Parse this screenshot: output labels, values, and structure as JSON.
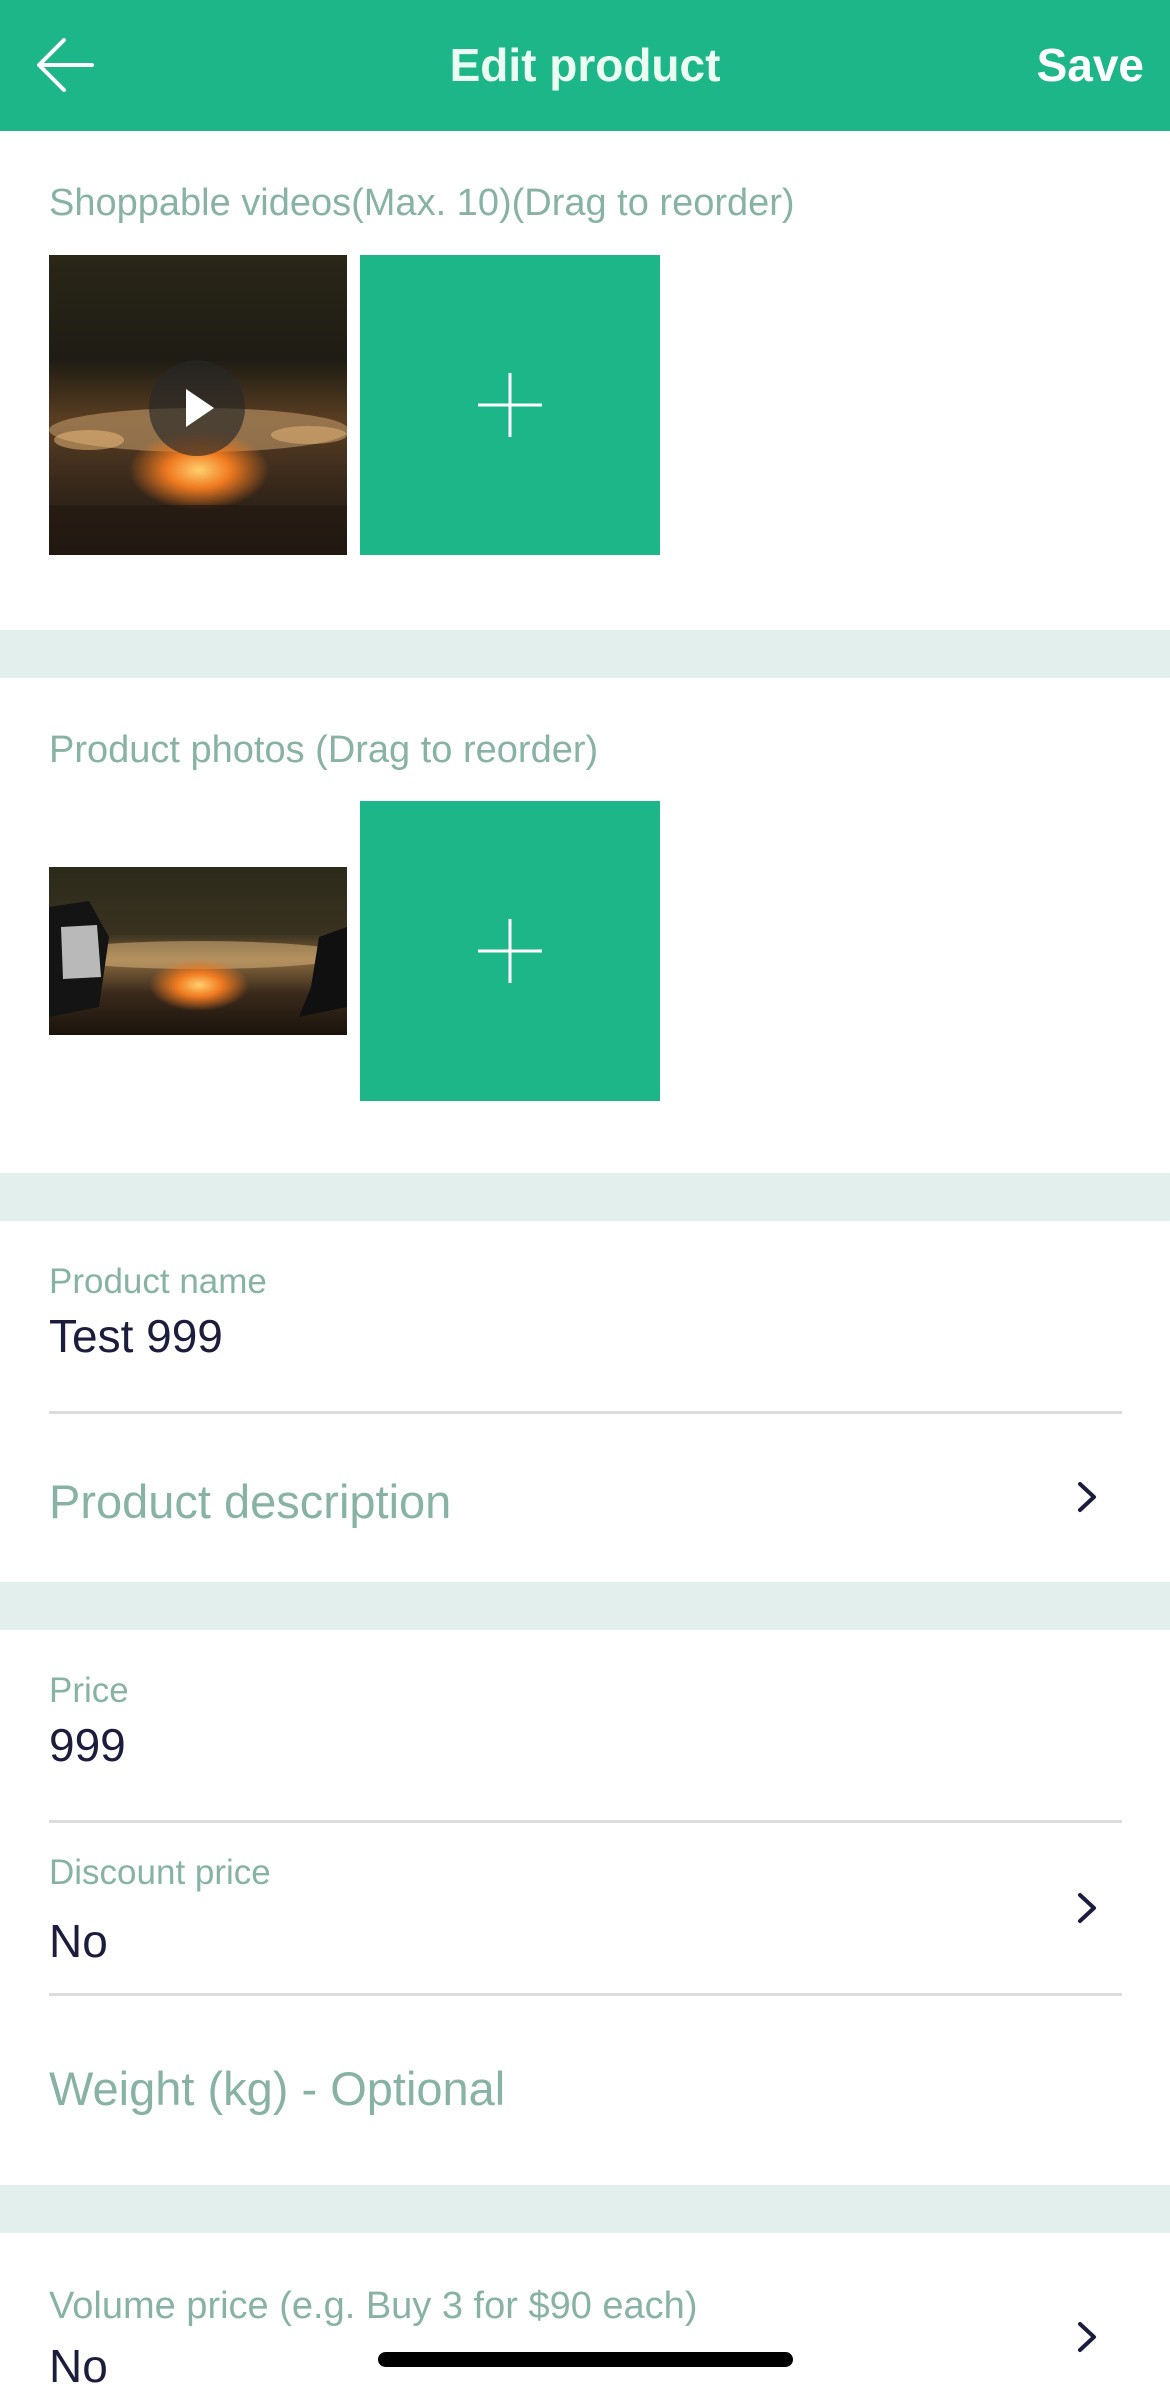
{
  "header": {
    "title": "Edit product",
    "save_label": "Save",
    "back_icon": "arrow-left-icon",
    "background": "#1db688"
  },
  "videos": {
    "label": "Shoppable videos(Max. 10)(Drag to reorder)",
    "add_icon": "plus-icon"
  },
  "photos": {
    "label": "Product photos (Drag to reorder)",
    "add_icon": "plus-icon"
  },
  "name": {
    "label": "Product name",
    "value": "Test 999"
  },
  "description": {
    "placeholder": "Product description"
  },
  "price": {
    "label": "Price",
    "value": "999"
  },
  "discount": {
    "label": "Discount price",
    "value": "No"
  },
  "weight": {
    "placeholder": "Weight (kg) - Optional"
  },
  "volume": {
    "label": "Volume price (e.g. Buy 3 for $90 each)",
    "value": "No"
  },
  "colors": {
    "accent": "#1db688",
    "label": "#89b2a6",
    "value": "#1c1c3c",
    "band": "#e2efec"
  }
}
